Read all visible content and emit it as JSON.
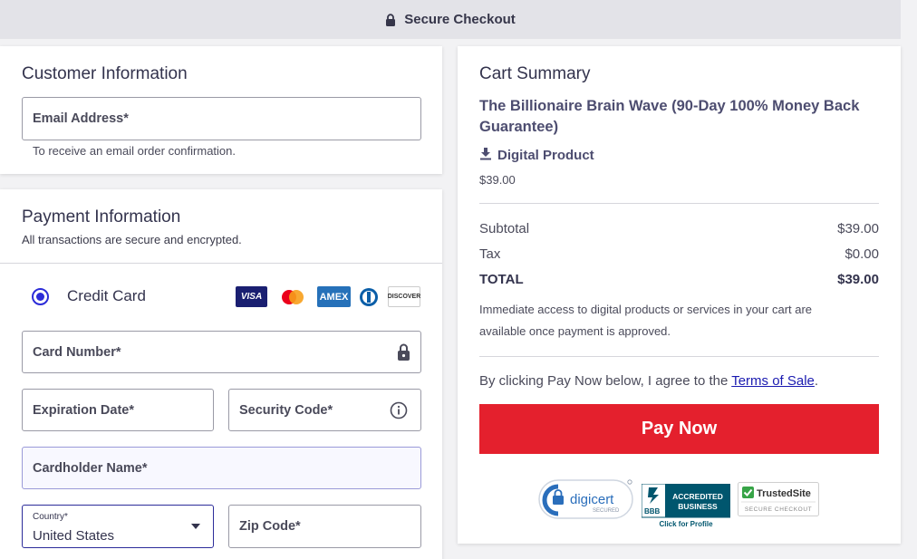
{
  "header": {
    "title": "Secure Checkout",
    "icon": "lock-icon"
  },
  "customer": {
    "title": "Customer Information",
    "email_label": "Email Address*",
    "email_hint": "To receive an email order confirmation."
  },
  "payment": {
    "title": "Payment Information",
    "subtitle": "All transactions are secure and encrypted.",
    "method_label": "Credit Card",
    "brands": [
      "VISA",
      "Mastercard",
      "AMEX",
      "Diners Club",
      "DISCOVER"
    ],
    "card_number_label": "Card Number*",
    "expiration_label": "Expiration Date*",
    "security_label": "Security Code*",
    "cardholder_label": "Cardholder Name*",
    "country_label": "Country*",
    "country_value": "United States",
    "zip_label": "Zip Code*"
  },
  "cart": {
    "title": "Cart Summary",
    "product_name": "The Billionaire Brain Wave (90-Day 100% Money Back Guarantee)",
    "product_type": "Digital Product",
    "product_price": "$39.00",
    "subtotal_label": "Subtotal",
    "subtotal_value": "$39.00",
    "tax_label": "Tax",
    "tax_value": "$0.00",
    "total_label": "TOTAL",
    "total_value": "$39.00",
    "note": "Immediate access to digital products or services in your cart are available once payment is approved.",
    "agree_prefix": "By clicking Pay Now below, I agree to the ",
    "terms_link": "Terms of Sale",
    "agree_suffix": ".",
    "pay_button": "Pay Now"
  },
  "badges": {
    "digicert": "digicert",
    "digicert_sub": "SECURED",
    "bbb_line1": "ACCREDITED",
    "bbb_line2": "BUSINESS",
    "bbb_mark": "BBB",
    "bbb_caption": "Click for Profile",
    "trusted": "TrustedSite",
    "trusted_sub": "SECURE CHECKOUT"
  },
  "colors": {
    "accent": "#2c2cd8",
    "pay_button": "#e4202d",
    "link": "#1a1ab0"
  }
}
